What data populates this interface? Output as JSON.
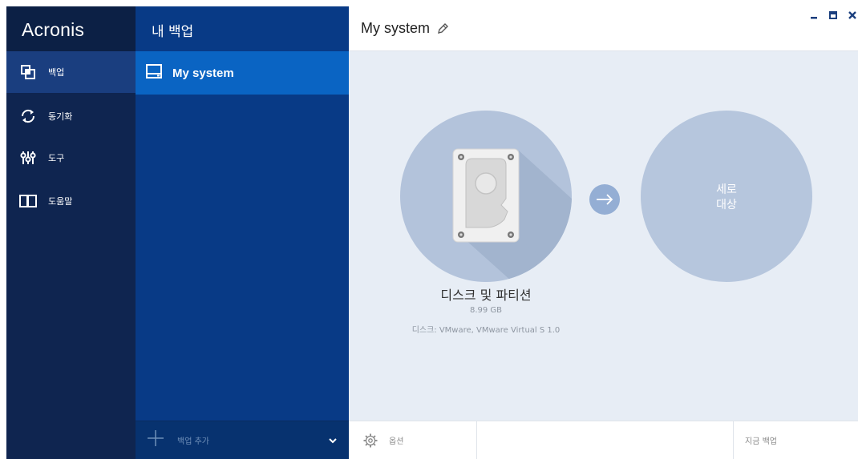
{
  "app": {
    "logo": "Acronis"
  },
  "nav": {
    "items": [
      {
        "label": "백업",
        "icon": "backup-icon"
      },
      {
        "label": "동기화",
        "icon": "sync-icon"
      },
      {
        "label": "도구",
        "icon": "tools-icon"
      },
      {
        "label": "도움말",
        "icon": "help-book-icon"
      }
    ]
  },
  "backups_panel": {
    "header": "내 백업",
    "items": [
      {
        "label": "My system",
        "icon": "drive-icon"
      }
    ],
    "footer": {
      "add_label": "백업 추가",
      "icons": [
        "plus-icon",
        "chevron-down-icon"
      ]
    }
  },
  "main": {
    "title": "My system",
    "title_icons": [
      "pencil-icon"
    ],
    "window_controls": [
      "minimize-icon",
      "maximize-icon",
      "close-icon"
    ],
    "source": {
      "name": "디스크 및 파티션",
      "size": "8.99 GB",
      "disk": "디스크: VMware, VMware Virtual S 1.0",
      "icon": "hard-drive-icon"
    },
    "arrow_icon": "arrow-right-icon",
    "destination": {
      "line1": "세로",
      "line2": "대상"
    },
    "bottom": {
      "options_label": "옵션",
      "options_icon": "gear-icon",
      "backup_now_label": "지금 백업"
    }
  },
  "colors": {
    "nav_bg": "#0f2550",
    "nav_active": "#1a3e7f",
    "panel_bg": "#083a86",
    "panel_selected": "#0a64c3",
    "main_bg": "#e7edf5",
    "circle": "#b3c3db"
  }
}
